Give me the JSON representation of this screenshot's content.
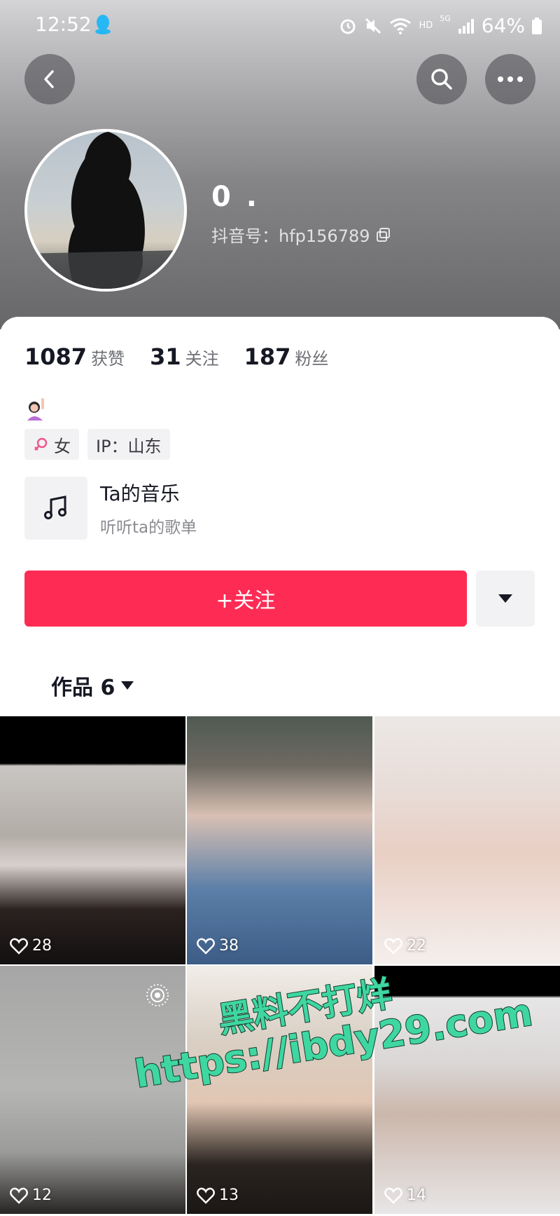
{
  "status_bar": {
    "time": "12:52",
    "battery": "64%",
    "network_hd": "HD",
    "network_5g": "5G"
  },
  "header": {
    "back_icon": "chevron-left-icon",
    "search_icon": "search-icon",
    "more_icon": "more-dots-icon"
  },
  "profile": {
    "nickname": "0 .",
    "douyin_id": "抖音号：hfp156789"
  },
  "stats": [
    {
      "num": "1087",
      "label": "获赞"
    },
    {
      "num": "31",
      "label": "关注"
    },
    {
      "num": "187",
      "label": "粉丝"
    }
  ],
  "tags": {
    "gender": "女",
    "ip": "IP：山东"
  },
  "music": {
    "title": "Ta的音乐",
    "subtitle": "听听ta的歌单"
  },
  "actions": {
    "follow_label": "+关注"
  },
  "works": {
    "tab_label": "作品 6"
  },
  "videos": [
    {
      "likes": "28"
    },
    {
      "likes": "38"
    },
    {
      "likes": "22"
    },
    {
      "likes": "12"
    },
    {
      "likes": "13"
    },
    {
      "likes": "14"
    }
  ],
  "watermark": {
    "line1": "黑料不打烊",
    "line2": "https://ibdy29.com"
  },
  "colors": {
    "follow_button": "#fe2c55",
    "watermark_fill": "#3fd7a1"
  }
}
